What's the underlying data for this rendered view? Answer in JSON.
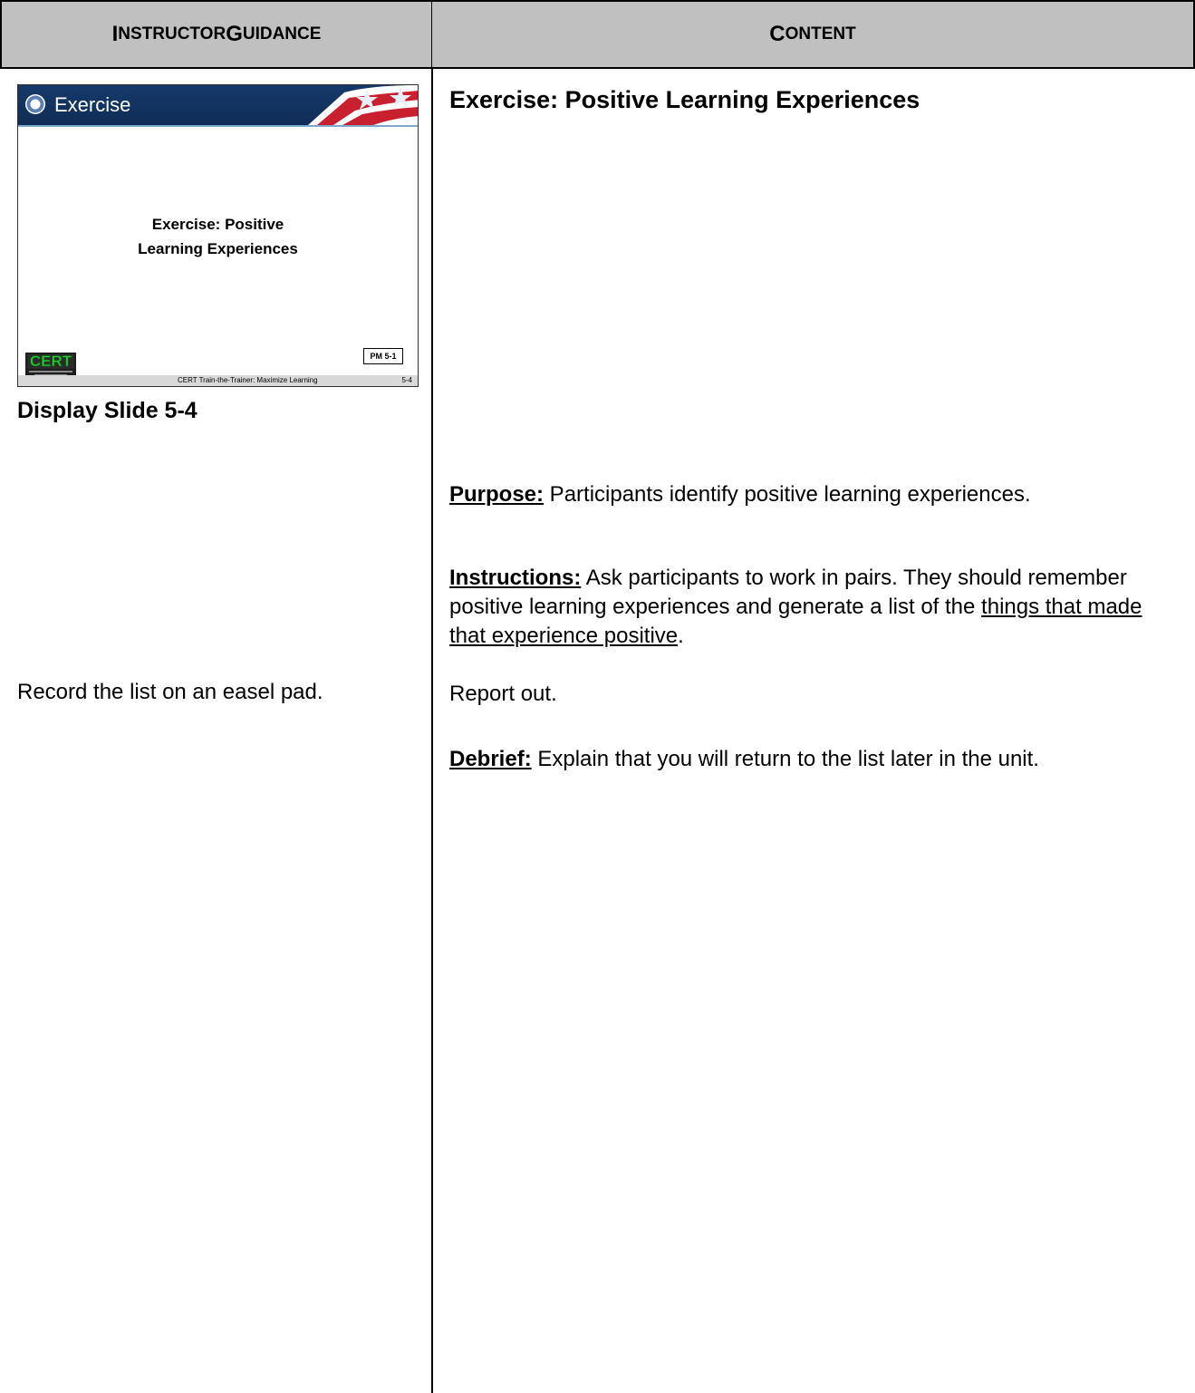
{
  "header": {
    "left_cap": "I",
    "left_rest": "NSTRUCTOR ",
    "left_cap2": "G",
    "left_rest2": "UIDANCE",
    "right_cap": "C",
    "right_rest": "ONTENT"
  },
  "slide": {
    "bar_title": "Exercise",
    "center_line1": "Exercise: Positive",
    "center_line2": "Learning Experiences",
    "pm_label": "PM 5-1",
    "footer_text": "CERT Train-the-Trainer:  Maximize Learning",
    "page": "5-4",
    "logo_text": "CERT"
  },
  "left": {
    "display_slide": "Display Slide 5-4",
    "record": "Record the list on an easel pad."
  },
  "right": {
    "title": "Exercise:  Positive Learning Experiences",
    "purpose_label": "Purpose:",
    "purpose_text": "  Participants identify positive learning experiences.",
    "instructions_label": "Instructions:",
    "instructions_text": "  Ask participants to work in pairs.  They should remember positive learning experiences and generate a list of the ",
    "instructions_ul": "things that made that experience positive",
    "instructions_end": ".",
    "report": "Report out.",
    "debrief_label": "Debrief:",
    "debrief_text": "  Explain that you will return to the list later in the unit."
  }
}
